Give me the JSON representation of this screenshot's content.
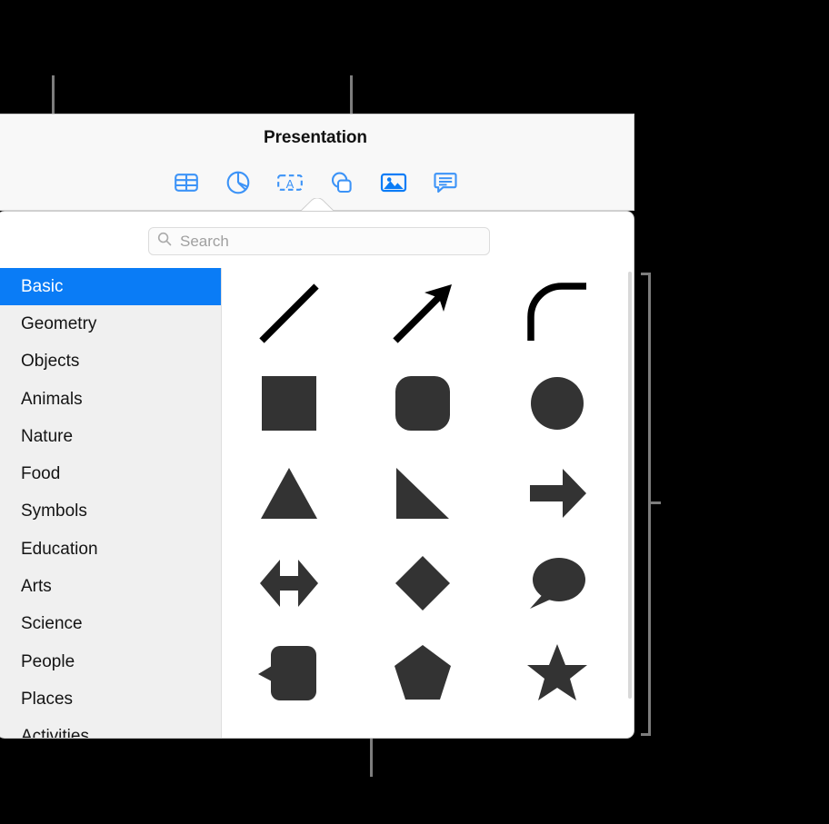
{
  "toolbar": {
    "title": "Presentation",
    "buttons": [
      {
        "name": "table-icon",
        "label": "Table"
      },
      {
        "name": "chart-icon",
        "label": "Chart"
      },
      {
        "name": "text-icon",
        "label": "Text"
      },
      {
        "name": "shape-icon",
        "label": "Shape"
      },
      {
        "name": "media-icon",
        "label": "Media"
      },
      {
        "name": "comment-icon",
        "label": "Comment"
      }
    ],
    "accent_color": "#0a7cf6"
  },
  "search": {
    "placeholder": "Search",
    "value": "",
    "icon": "search-icon"
  },
  "sidebar": {
    "selected": "Basic",
    "items": [
      {
        "label": "Basic"
      },
      {
        "label": "Geometry"
      },
      {
        "label": "Objects"
      },
      {
        "label": "Animals"
      },
      {
        "label": "Nature"
      },
      {
        "label": "Food"
      },
      {
        "label": "Symbols"
      },
      {
        "label": "Education"
      },
      {
        "label": "Arts"
      },
      {
        "label": "Science"
      },
      {
        "label": "People"
      },
      {
        "label": "Places"
      },
      {
        "label": "Activities"
      }
    ],
    "selection_color": "#0a7cf6",
    "background_color": "#f0f0f0"
  },
  "shapes": {
    "fill_color": "#333333",
    "items": [
      {
        "name": "line-shape",
        "label": "Line"
      },
      {
        "name": "arrow-shape",
        "label": "Arrow"
      },
      {
        "name": "curved-line-shape",
        "label": "Curved Line"
      },
      {
        "name": "square-shape",
        "label": "Square"
      },
      {
        "name": "rounded-square-shape",
        "label": "Rounded Square"
      },
      {
        "name": "circle-shape",
        "label": "Circle"
      },
      {
        "name": "triangle-shape",
        "label": "Triangle"
      },
      {
        "name": "right-triangle-shape",
        "label": "Right Triangle"
      },
      {
        "name": "block-arrow-shape",
        "label": "Block Arrow"
      },
      {
        "name": "double-arrow-shape",
        "label": "Double Arrow"
      },
      {
        "name": "diamond-shape",
        "label": "Diamond"
      },
      {
        "name": "speech-bubble-shape",
        "label": "Speech Bubble"
      },
      {
        "name": "callout-shape",
        "label": "Callout"
      },
      {
        "name": "pentagon-shape",
        "label": "Pentagon"
      },
      {
        "name": "star-shape",
        "label": "Star"
      }
    ]
  },
  "callouts": {
    "line_color": "#7d7d7d"
  }
}
